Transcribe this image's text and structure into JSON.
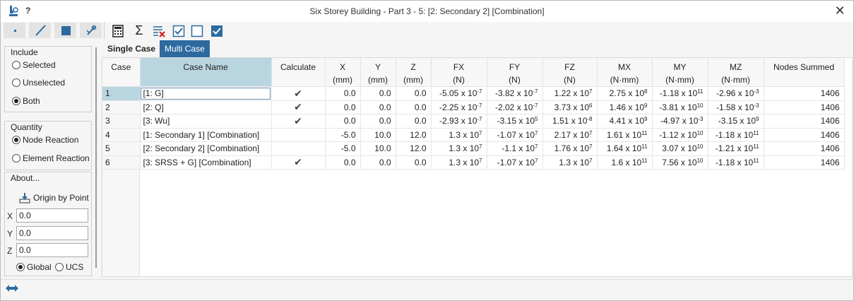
{
  "window": {
    "title": "Six Storey Building - Part 3 - 5: [2: Secondary 2] [Combination]",
    "help": "?",
    "close": "✕"
  },
  "toolbar": {
    "buttons": [
      "node-icon",
      "line-icon",
      "area-icon",
      "tools-icon",
      "calculator-icon",
      "sum-icon",
      "clear-list-icon",
      "check-all-icon",
      "uncheck-all-icon",
      "check-selected-icon"
    ],
    "sum_glyph": "Σ"
  },
  "left": {
    "include": {
      "title": "Include",
      "options": [
        "Selected",
        "Unselected",
        "Both"
      ],
      "selected": "Both"
    },
    "quantity": {
      "title": "Quantity",
      "options": [
        "Node Reaction",
        "Element Reaction"
      ],
      "selected": "Node Reaction"
    },
    "about": {
      "title": "About...",
      "origin_button": "Origin by Point",
      "x_label": "X",
      "y_label": "Y",
      "z_label": "Z",
      "x_value": "0.0",
      "y_value": "0.0",
      "z_value": "0.0",
      "coord_options": [
        "Global",
        "UCS"
      ],
      "coord_selected": "Global"
    }
  },
  "tabs": {
    "single": "Single Case",
    "multi": "Multi Case",
    "active": "Multi Case"
  },
  "table": {
    "headers": [
      {
        "l1": "Case",
        "l2": ""
      },
      {
        "l1": "Case Name",
        "l2": ""
      },
      {
        "l1": "Calculate",
        "l2": ""
      },
      {
        "l1": "X",
        "l2": "(mm)"
      },
      {
        "l1": "Y",
        "l2": "(mm)"
      },
      {
        "l1": "Z",
        "l2": "(mm)"
      },
      {
        "l1": "FX",
        "l2": "(N)"
      },
      {
        "l1": "FY",
        "l2": "(N)"
      },
      {
        "l1": "FZ",
        "l2": "(N)"
      },
      {
        "l1": "MX",
        "l2": "(N·mm)"
      },
      {
        "l1": "MY",
        "l2": "(N·mm)"
      },
      {
        "l1": "MZ",
        "l2": "(N·mm)"
      },
      {
        "l1": "Nodes Summed",
        "l2": ""
      }
    ],
    "check_glyph": "✔",
    "rows": [
      {
        "case": "1",
        "name": "[1: G]",
        "calc": true,
        "x": "0.0",
        "y": "0.0",
        "z": "0.0",
        "fx": {
          "m": "-5.05",
          "e": "-7"
        },
        "fy": {
          "m": "-3.82",
          "e": "-7"
        },
        "fz": {
          "m": "1.22",
          "e": "7"
        },
        "mx": {
          "m": "2.75",
          "e": "8"
        },
        "my": {
          "m": "-1.18",
          "e": "11"
        },
        "mz": {
          "m": "-2.96",
          "e": "-3"
        },
        "nodes": "1406"
      },
      {
        "case": "2",
        "name": "[2: Q]",
        "calc": true,
        "x": "0.0",
        "y": "0.0",
        "z": "0.0",
        "fx": {
          "m": "-2.25",
          "e": "-7"
        },
        "fy": {
          "m": "-2.02",
          "e": "-7"
        },
        "fz": {
          "m": "3.73",
          "e": "6"
        },
        "mx": {
          "m": "1.46",
          "e": "9"
        },
        "my": {
          "m": "-3.81",
          "e": "10"
        },
        "mz": {
          "m": "-1.58",
          "e": "-3"
        },
        "nodes": "1406"
      },
      {
        "case": "3",
        "name": "[3: Wu]",
        "calc": true,
        "x": "0.0",
        "y": "0.0",
        "z": "0.0",
        "fx": {
          "m": "-2.93",
          "e": "-7"
        },
        "fy": {
          "m": "-3.15",
          "e": "5"
        },
        "fz": {
          "m": "1.51",
          "e": "-8"
        },
        "mx": {
          "m": "4.41",
          "e": "9"
        },
        "my": {
          "m": "-4.97",
          "e": "-3"
        },
        "mz": {
          "m": "-3.15",
          "e": "9"
        },
        "nodes": "1406"
      },
      {
        "case": "4",
        "name": "[1: Secondary 1] [Combination]",
        "calc": false,
        "x": "-5.0",
        "y": "10.0",
        "z": "12.0",
        "fx": {
          "m": "1.3",
          "e": "7"
        },
        "fy": {
          "m": "-1.07",
          "e": "7"
        },
        "fz": {
          "m": "2.17",
          "e": "7"
        },
        "mx": {
          "m": "1.61",
          "e": "11"
        },
        "my": {
          "m": "-1.12",
          "e": "10"
        },
        "mz": {
          "m": "-1.18",
          "e": "11"
        },
        "nodes": "1406"
      },
      {
        "case": "5",
        "name": "[2: Secondary 2] [Combination]",
        "calc": false,
        "x": "-5.0",
        "y": "10.0",
        "z": "12.0",
        "fx": {
          "m": "1.3",
          "e": "7"
        },
        "fy": {
          "m": "-1.1",
          "e": "7"
        },
        "fz": {
          "m": "1.76",
          "e": "7"
        },
        "mx": {
          "m": "1.64",
          "e": "11"
        },
        "my": {
          "m": "3.07",
          "e": "10"
        },
        "mz": {
          "m": "-1.21",
          "e": "11"
        },
        "nodes": "1406"
      },
      {
        "case": "6",
        "name": "[3: SRSS + G] [Combination]",
        "calc": true,
        "x": "0.0",
        "y": "0.0",
        "z": "0.0",
        "fx": {
          "m": "1.3",
          "e": "7"
        },
        "fy": {
          "m": "-1.07",
          "e": "7"
        },
        "fz": {
          "m": "1.3",
          "e": "7"
        },
        "mx": {
          "m": "1.6",
          "e": "11"
        },
        "my": {
          "m": "7.56",
          "e": "10"
        },
        "mz": {
          "m": "-1.18",
          "e": "11"
        },
        "nodes": "1406"
      }
    ],
    "selected_case": "1"
  },
  "colors": {
    "accent": "#2c6aa0",
    "selection": "#b9d6e0"
  }
}
